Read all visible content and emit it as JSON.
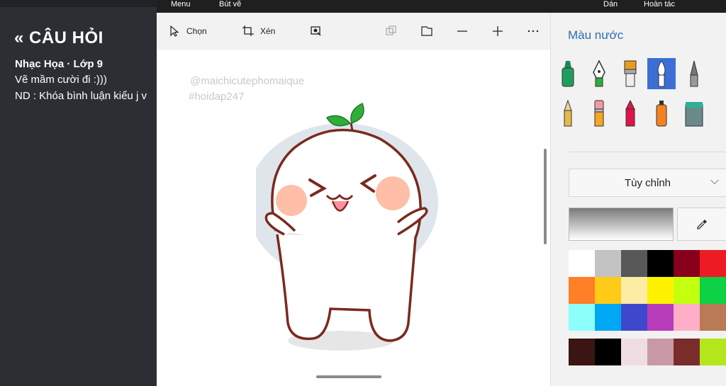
{
  "question_panel": {
    "header": "« CÂU HỎI",
    "subject": "Nhạc Họa · Lớp 9",
    "line1": "Vẽ mầm cười đi :)))",
    "line2": "ND : Khóa bình luận kiểu j v"
  },
  "top_strip": {
    "menu": "Menu",
    "brush": "Bút vẽ",
    "paste": "Dán",
    "undo": "Hoàn tác"
  },
  "toolbar": {
    "select_label": "Chọn",
    "crop_label": "Xén"
  },
  "canvas": {
    "watermark_user": "@maichicutephomaique",
    "watermark_tag": "#hoidap247"
  },
  "side_panel": {
    "title": "Màu nước",
    "brushes": [
      "marker",
      "calligraphy-pen",
      "oil-brush",
      "watercolor",
      "pencil-tip",
      "pencil",
      "eraser",
      "crayon",
      "spray-can",
      "pixel-pen"
    ],
    "selected_brush": "watercolor",
    "dropdown_value": "Tùy chỉnh",
    "palette": [
      "#ffffff",
      "#c3c3c3",
      "#585858",
      "#000000",
      "#88001b",
      "#ec1c24",
      "#ff7f27",
      "#ffca18",
      "#fdeca6",
      "#fff200",
      "#c4ff0e",
      "#0ed145",
      "#8cfffb",
      "#00a8f3",
      "#3f48cc",
      "#b83dba",
      "#ffaec8",
      "#b97a56"
    ],
    "recent": [
      "#3b1414",
      "#000000",
      "#f0dde3",
      "#c99aa6",
      "#7a2c2c",
      "#b5e61d"
    ]
  },
  "colors": {
    "accent": "#3b6fd6",
    "title_blue": "#2a6fb0",
    "outline_brown": "#7a2a1e",
    "cheek": "#ffa88a",
    "leaf": "#2fae3a"
  }
}
